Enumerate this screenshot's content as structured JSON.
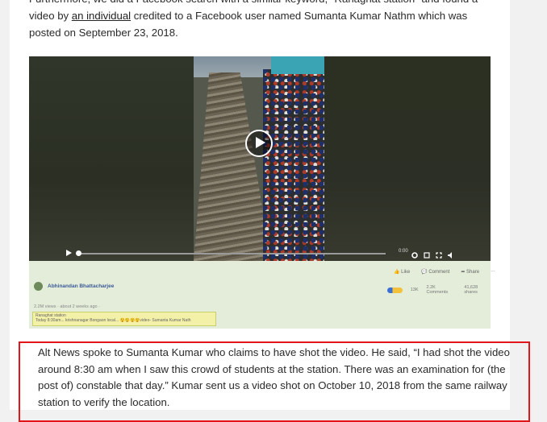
{
  "article": {
    "para1_before_link": "Furthermore, we did a Facebook search with a similar keyword, \"Ranaghat station\" and found a video by",
    "para1_link": "an individual",
    "para1_after_link": "credited to a Facebook user named Sumanta Kumar Nathm which was posted on September 23, 2018.",
    "para2": "Alt News spoke to Sumanta Kumar who claims to have shot the video. He said, “I had shot the video around 8:30 am when I saw this crowd of students at the station. There was an examination for (the post of) constable that day.” Kumar sent us a video shot on October 10, 2018 from the same railway station to verify the location."
  },
  "video": {
    "time": "0:00",
    "progress": 0
  },
  "facebook": {
    "actions": [
      "Like",
      "Comment",
      "Share"
    ],
    "author": "Abhinandan Bhattacharjee",
    "reactions_count": "13K",
    "comments": "2.2K Comments",
    "shares": "41,628 shares",
    "meta": "2.2M views · about 2 weeks ago ·",
    "caption_line1": "Ranaghat station",
    "caption_line2": "Today 8:30am... krishnanagar Bongaon local... 😲😲😲😲video- Sumanta Kumar Nath"
  },
  "colors": {
    "highlight_border": "#e2151b",
    "embed_background": "#e3edd9",
    "link": "#3b5998"
  },
  "icons": [
    "play-icon",
    "settings-icon",
    "expand-icon",
    "fullscreen-icon",
    "volume-icon",
    "like-icon",
    "comment-icon",
    "share-icon"
  ]
}
